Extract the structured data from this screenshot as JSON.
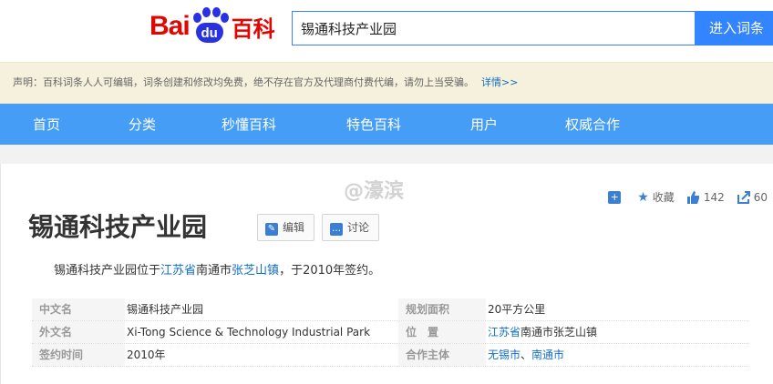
{
  "header": {
    "logo_bai": "Bai",
    "logo_du": "du",
    "logo_baike": "百科",
    "search_value": "锡通科技产业园",
    "search_button": "进入词条"
  },
  "notice": {
    "text": "声明：百科词条人人可编辑，词条创建和修改均免费，绝不存在官方及代理商付费代编，请勿上当受骗。",
    "more": "详情>>"
  },
  "nav": {
    "items": [
      "首页",
      "分类",
      "秒懂百科",
      "特色百科",
      "用户",
      "权威合作"
    ]
  },
  "watermark": "@濠滨",
  "tools": {
    "add": "+",
    "favorite_label": "收藏",
    "like_count": "142",
    "share_count": "60"
  },
  "title": "锡通科技产业园",
  "buttons": {
    "edit": "编辑",
    "discuss": "讨论"
  },
  "summary": {
    "part1": "锡通科技产业园位于",
    "link1": "江苏省",
    "part2": "南通市",
    "link2": "张芝山镇",
    "part3": "，于2010年签约。"
  },
  "info": {
    "rows": [
      {
        "k1": "中文名",
        "v1": "锡通科技产业园",
        "k2": "规划面积",
        "v2": "20平方公里"
      },
      {
        "k1": "外文名",
        "v1": "Xi-Tong Science & Technology Industrial Park",
        "k2": "位　置",
        "v2_link": "江苏省",
        "v2_rest": "南通市张芝山镇"
      },
      {
        "k1": "签约时间",
        "v1": "2010年",
        "k2": "合作主体",
        "v2_link1": "无锡市",
        "v2_sep": "、",
        "v2_link2": "南通市"
      }
    ]
  }
}
